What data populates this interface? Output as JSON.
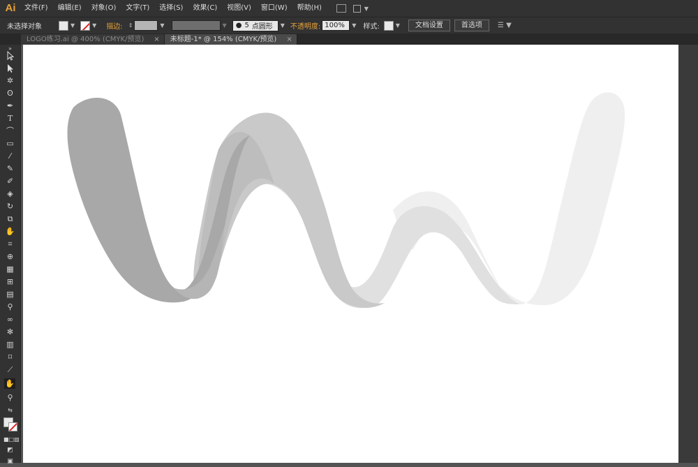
{
  "app": {
    "logo": "Ai"
  },
  "menu": [
    "文件(F)",
    "编辑(E)",
    "对象(O)",
    "文字(T)",
    "选择(S)",
    "效果(C)",
    "视图(V)",
    "窗口(W)",
    "帮助(H)"
  ],
  "control": {
    "selection": "未选择对象",
    "stroke_label": "描边:",
    "brush_value": "5",
    "brush_name": "点圆形",
    "opacity_label": "不透明度:",
    "opacity_value": "100%",
    "style_label": "样式:",
    "doc_setup": "文档设置",
    "preferences": "首选项"
  },
  "tabs": [
    {
      "label": "LOGO练习.ai @ 400% (CMYK/预览)",
      "close": "×"
    },
    {
      "label": "未标题-1* @ 154% (CMYK/预览)",
      "close": "×"
    }
  ],
  "colors": {
    "accent": "#e8a23a",
    "ribbon_dark": "#a8a8a8",
    "ribbon_mid": "#c9c9c9",
    "ribbon_light": "#e3e3e3",
    "ribbon_lightest": "#efefef"
  },
  "tools": [
    "selection-tool",
    "direct-selection-tool",
    "magic-wand-tool",
    "lasso-tool",
    "pen-tool",
    "type-tool",
    "line-tool",
    "rectangle-tool",
    "paintbrush-tool",
    "pencil-tool",
    "blob-brush-tool",
    "eraser-tool",
    "rotate-tool",
    "scale-tool",
    "warp-tool",
    "free-transform-tool",
    "shape-builder-tool",
    "perspective-grid-tool",
    "mesh-tool",
    "gradient-tool",
    "eyedropper-tool",
    "blend-tool",
    "symbol-sprayer-tool",
    "column-graph-tool",
    "artboard-tool",
    "slice-tool",
    "hand-tool",
    "zoom-tool"
  ]
}
